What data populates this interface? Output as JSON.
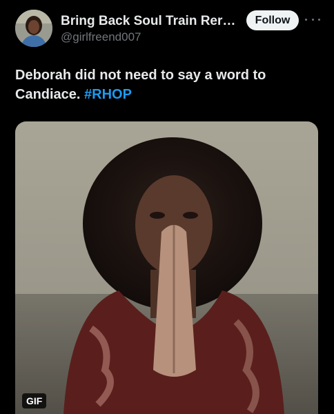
{
  "tweet": {
    "author": {
      "display_name": "Bring Back Soul Train Rerun...",
      "handle": "@girlfreend007"
    },
    "follow_label": "Follow",
    "more_icon": "more-horizontal-icon",
    "text": "Deborah did not need to say a word to Candiace.",
    "hashtag": "#RHOP",
    "media": {
      "badge": "GIF"
    }
  },
  "colors": {
    "background": "#000000",
    "primary_text": "#e7e9ea",
    "secondary_text": "#71767b",
    "link": "#1d9bf0",
    "follow_bg": "#eff3f4"
  }
}
